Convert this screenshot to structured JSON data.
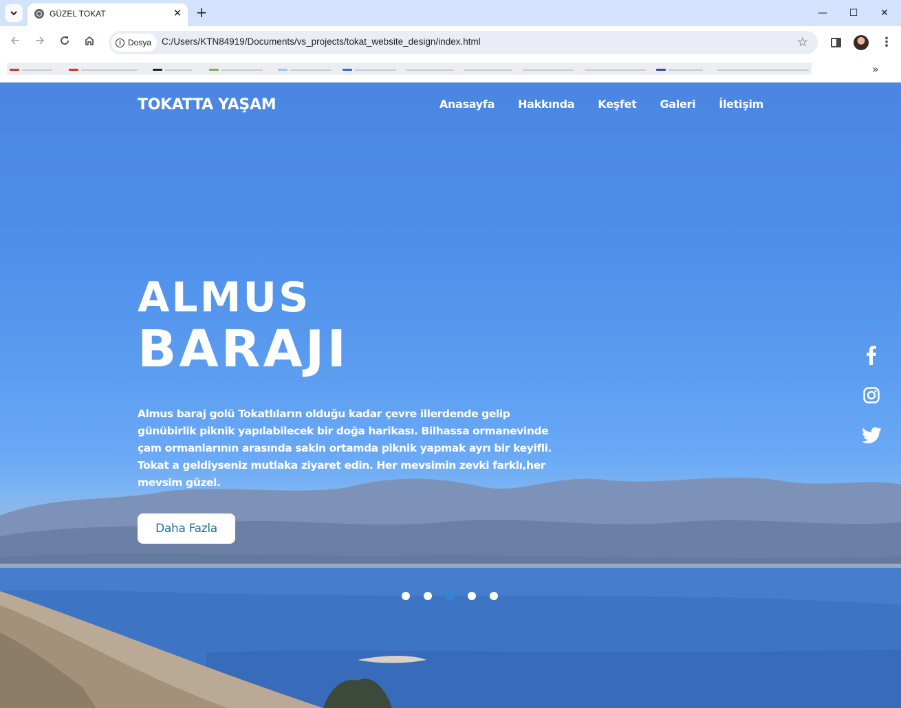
{
  "browser": {
    "tab_title": "GÜZEL TOKAT",
    "tab_close": "✕",
    "new_tab": "+",
    "site_chip": "Dosya",
    "url": "C:/Users/KTN84919/Documents/vs_projects/tokat_website_design/index.html",
    "window_controls": {
      "minimize": "—",
      "maximize": "☐",
      "close": "✕"
    },
    "bookmarks_more": "»"
  },
  "site": {
    "brand": "TOKATTA YAŞAM",
    "nav": [
      "Anasayfa",
      "Hakkında",
      "Keşfet",
      "Galeri",
      "İletişim"
    ],
    "hero": {
      "title_line1": "ALMUS",
      "title_line2": "BARAJI",
      "description": "Almus baraj golü Tokatlıların olduğu kadar çevre illerdende gelip günübirlik piknik yapılabilecek bir doğa harikası. Bilhassa ormanevinde çam ormanlarının arasında sakin ortamda piknik yapmak ayrı bir keyifli. Tokat a geldiyseniz mutlaka ziyaret edin. Her mevsimin zevki farklı,her mevsim güzel.",
      "button_label": "Daha Fazla"
    },
    "social": [
      "facebook-icon",
      "instagram-icon",
      "twitter-icon"
    ],
    "slider": {
      "slide_count": 5,
      "active_index": 2
    }
  },
  "colors": {
    "accent": "#2e86d8",
    "button_text": "#1a6fa0",
    "sky": "#4d8eea",
    "tab_strip": "#d3e3fd"
  }
}
